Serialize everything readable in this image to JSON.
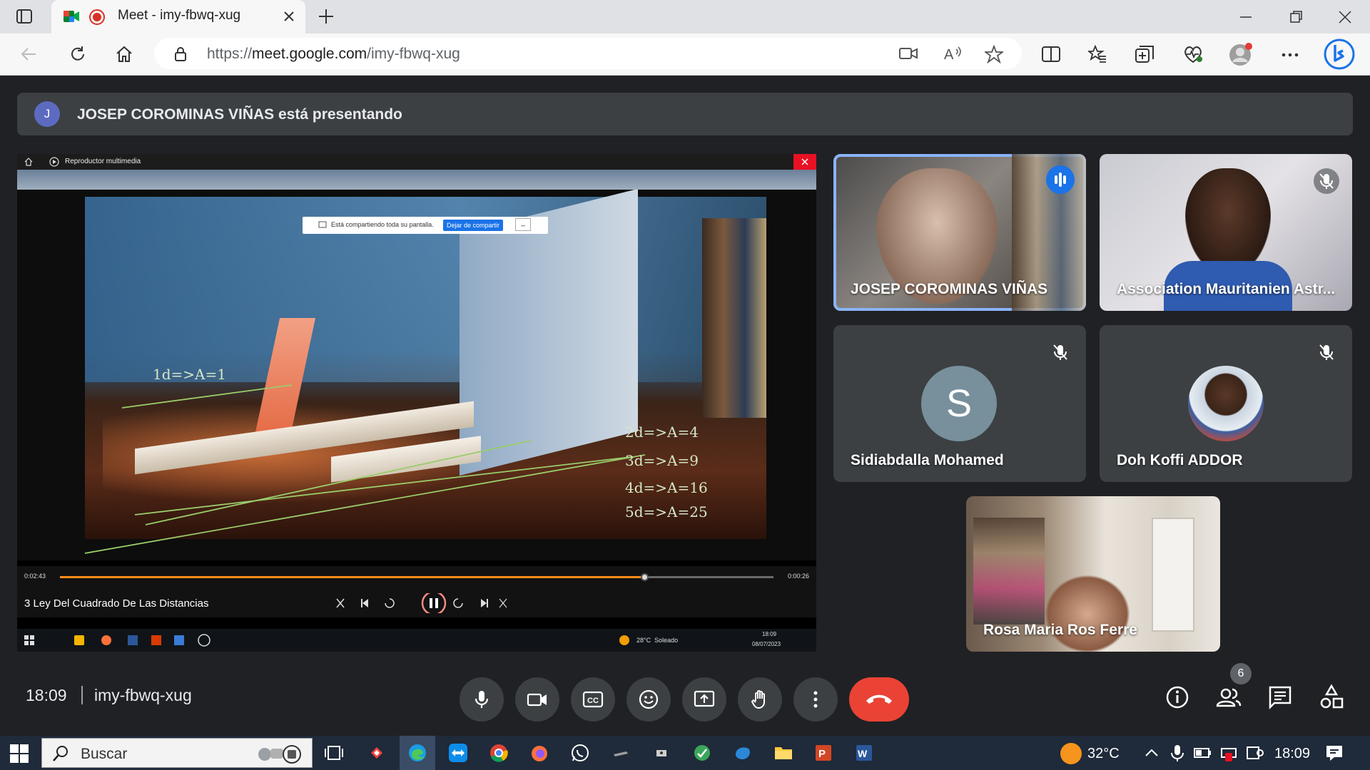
{
  "browser": {
    "tab_title": "Meet - imy-fbwq-xug",
    "url_prefix": "https://",
    "url_host": "meet.google.com",
    "url_path": "/imy-fbwq-xug"
  },
  "meet": {
    "presenter_initial": "J",
    "presenting_banner": "JOSEP COROMINAS VIÑAS está presentando",
    "participants": [
      {
        "name": "JOSEP COROMINAS VIÑAS",
        "state": "speaking"
      },
      {
        "name": "Association Mauritanien Astr...",
        "state": "muted"
      },
      {
        "name": "Sidiabdalla Mohamed",
        "initial": "S",
        "state": "muted"
      },
      {
        "name": "Doh Koffi ADDOR",
        "state": "muted"
      },
      {
        "name": "Rosa Maria Ros Ferre",
        "state": "video"
      }
    ],
    "time": "18:09",
    "meeting_code": "imy-fbwq-xug",
    "participant_count": "6"
  },
  "shared_screen": {
    "window_title": "Reproductor multimedia",
    "sharing_notice": "Está compartiendo toda su pantalla.",
    "stop_sharing_button": "Dejar de compartir",
    "hide_button": "_",
    "video_labels": [
      "1d=>A=1",
      "2d=>A=4",
      "3d=>A=9",
      "4d=>A=16",
      "5d=>A=25"
    ],
    "elapsed": "0:02:43",
    "remaining": "0:00:26",
    "progress_fraction": 0.82,
    "media_title": "3 Ley Del Cuadrado De Las Distancias",
    "weather": "28°C  Soleado",
    "clock_time": "18:09",
    "clock_date": "08/07/2023"
  },
  "taskbar": {
    "search_placeholder": "Buscar",
    "weather": "32°C",
    "time": "18:09"
  },
  "colors": {
    "meet_bg": "#202124",
    "tile_bg": "#3c4043",
    "end_call": "#ea4335",
    "speaking_outline": "#8ab4f8",
    "progress": "#ff8c1a"
  }
}
